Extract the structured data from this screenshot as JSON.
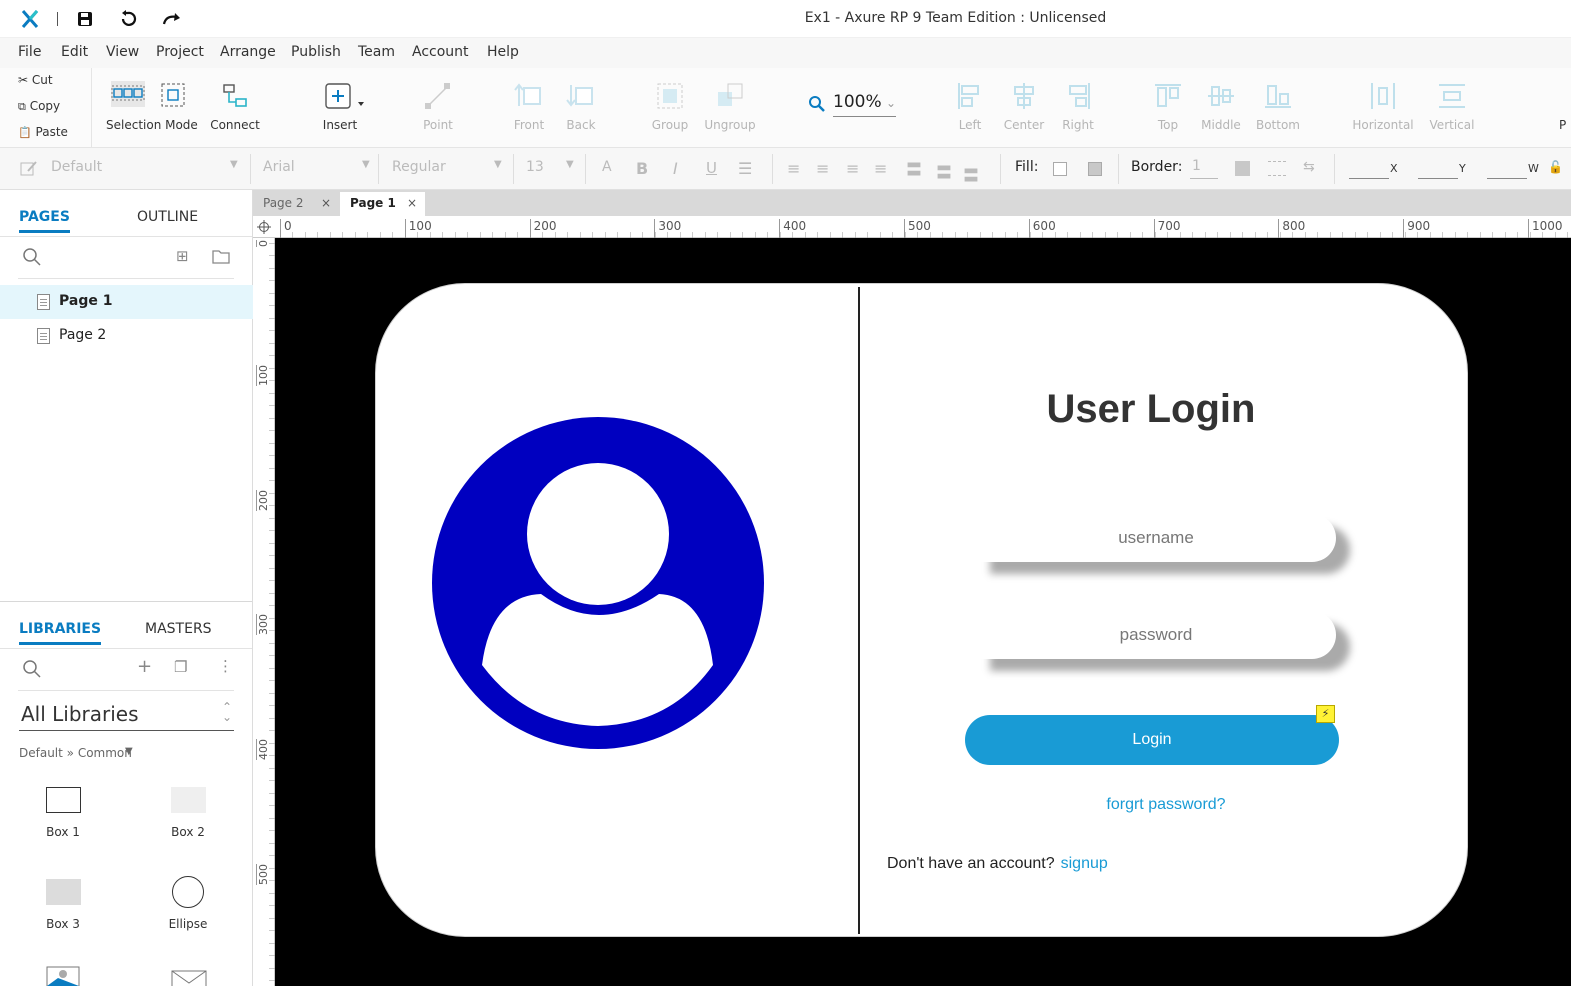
{
  "window": {
    "title": "Ex1 - Axure RP 9 Team Edition : Unlicensed"
  },
  "menu": [
    "File",
    "Edit",
    "View",
    "Project",
    "Arrange",
    "Publish",
    "Team",
    "Account",
    "Help"
  ],
  "clipboard": {
    "cut": "Cut",
    "copy": "Copy",
    "paste": "Paste"
  },
  "toolbar": {
    "selection_mode": "Selection Mode",
    "connect": "Connect",
    "insert": "Insert",
    "point": "Point",
    "front": "Front",
    "back": "Back",
    "group": "Group",
    "ungroup": "Ungroup",
    "zoom": "100%",
    "left": "Left",
    "center": "Center",
    "right": "Right",
    "top": "Top",
    "middle": "Middle",
    "bottom": "Bottom",
    "horizontal": "Horizontal",
    "vertical": "Vertical",
    "cut_off": "P"
  },
  "format": {
    "style": "Default",
    "font": "Arial",
    "weight": "Regular",
    "size": "13",
    "fill_label": "Fill:",
    "border_label": "Border:",
    "border_value": "1",
    "x_label": "X",
    "y_label": "Y",
    "w_label": "W"
  },
  "left_panel": {
    "tabs": {
      "pages": "PAGES",
      "outline": "OUTLINE"
    },
    "pages": [
      "Page 1",
      "Page 2"
    ],
    "lib_tabs": {
      "libraries": "LIBRARIES",
      "masters": "MASTERS"
    },
    "library_select": "All Libraries",
    "library_path": "Default » Common",
    "widgets": [
      "Box 1",
      "Box 2",
      "Box 3",
      "Ellipse"
    ]
  },
  "doc_tabs": [
    "Page 2",
    "Page 1"
  ],
  "ruler": {
    "h_ticks": [
      "0",
      "100",
      "200",
      "300",
      "400",
      "500",
      "600",
      "700",
      "800",
      "900",
      "1000"
    ],
    "v_ticks": [
      "0",
      "100",
      "200",
      "300",
      "400",
      "500"
    ]
  },
  "mockup": {
    "title": "User Login",
    "username_placeholder": "username",
    "password_placeholder": "password",
    "login_button": "Login",
    "forgot_link": "forgrt password?",
    "no_account": "Don't have an account?",
    "signup_link": "signup",
    "avatar_color": "#0000c0",
    "accent_color": "#199bd5"
  }
}
